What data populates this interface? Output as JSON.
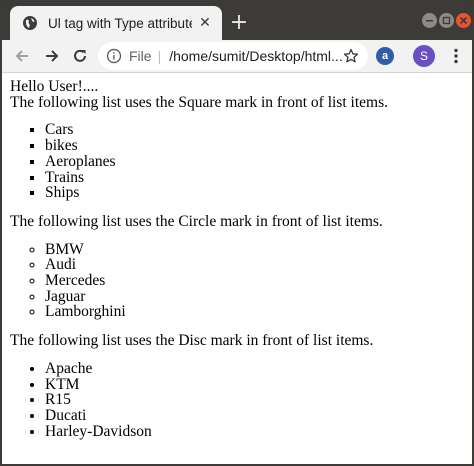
{
  "browser": {
    "tab_title": "Ul tag with Type attribute",
    "tab_close": "✕",
    "new_tab": "+",
    "address": {
      "scheme_label": "File",
      "separator": "|",
      "url": "/home/sumit/Desktop/html..."
    },
    "extension_label": "a",
    "profile_initial": "S"
  },
  "page": {
    "greeting": "Hello User!....",
    "sections": [
      {
        "intro": "The following list uses the Square mark in front of list items.",
        "items": [
          "Cars",
          "bikes",
          "Aeroplanes",
          "Trains",
          "Ships"
        ]
      },
      {
        "intro": "The following list uses the Circle mark in front of list items.",
        "items": [
          "BMW",
          "Audi",
          "Mercedes",
          "Jaguar",
          "Lamborghini"
        ]
      },
      {
        "intro": "The following list uses the Disc mark in front of list items.",
        "items": [
          "Apache",
          "KTM",
          "R15",
          "Ducati",
          "Harley-Davidson"
        ]
      }
    ]
  },
  "colors": {
    "titlebar": "#3c3b37",
    "toolbar": "#f2f2f2",
    "close_button": "#e9542d",
    "avatar": "#6a4fc3"
  }
}
